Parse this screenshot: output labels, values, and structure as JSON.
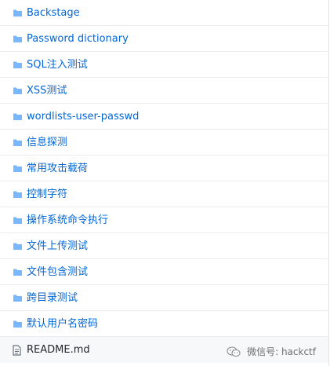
{
  "files": [
    {
      "label": "Backstage",
      "icon": "folder-icon"
    },
    {
      "label": "Password dictionary",
      "icon": "folder-icon"
    },
    {
      "label": "SQL注入测试",
      "icon": "folder-icon"
    },
    {
      "label": "XSS测试",
      "icon": "folder-icon"
    },
    {
      "label": "wordlists-user-passwd",
      "icon": "folder-icon"
    },
    {
      "label": "信息探测",
      "icon": "folder-icon"
    },
    {
      "label": "常用攻击载荷",
      "icon": "folder-icon"
    },
    {
      "label": "控制字符",
      "icon": "folder-icon"
    },
    {
      "label": "操作系统命令执行",
      "icon": "folder-icon"
    },
    {
      "label": "文件上传测试",
      "icon": "folder-icon"
    },
    {
      "label": "文件包含测试",
      "icon": "folder-icon"
    },
    {
      "label": "跨目录测试",
      "icon": "folder-icon"
    },
    {
      "label": "默认用户名密码",
      "icon": "folder-icon"
    }
  ],
  "readme": {
    "label": "README.md",
    "icon": "file-icon"
  },
  "watermark": {
    "text": "微信号: hackctf",
    "icon": "wechat-icon"
  },
  "colors": {
    "folder": "#79b8ff",
    "link": "#0366d6",
    "border": "#eaecef",
    "last_row_bg": "#f6f8fa"
  }
}
